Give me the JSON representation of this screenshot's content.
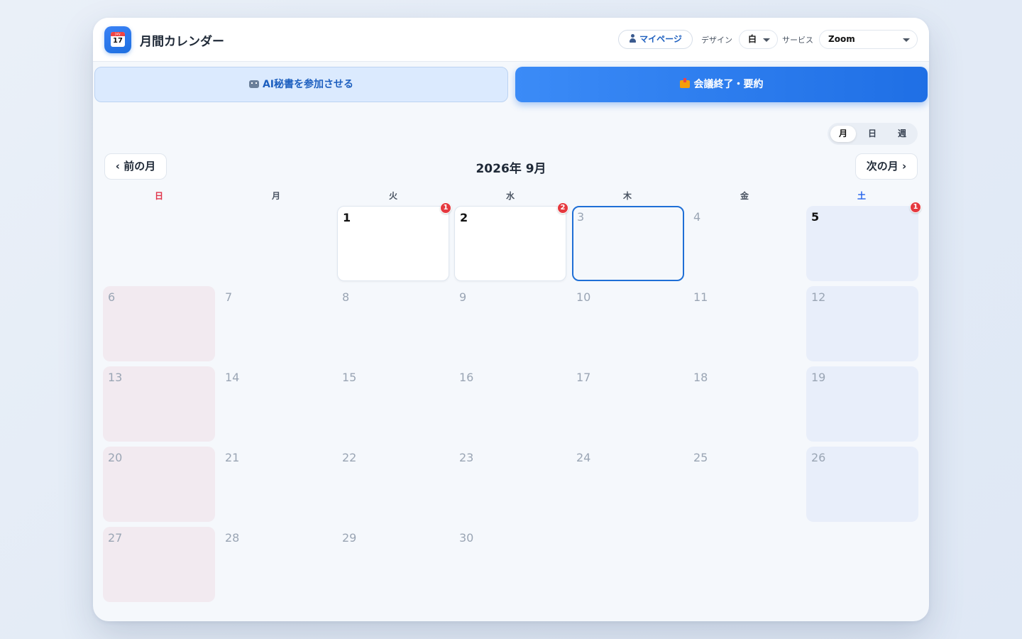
{
  "header": {
    "app_icon": "calendar-icon",
    "app_icon_month": "July",
    "app_icon_day": "17",
    "title": "月間カレンダー",
    "mypage_label": "マイページ",
    "design_label": "デザイン",
    "design_value": "白",
    "service_label": "サービス",
    "service_value": "Zoom"
  },
  "actions": {
    "ai_join": "AI秘書を参加させる",
    "end_meeting": "会議終了・要約"
  },
  "view_toggle": {
    "month": "月",
    "day": "日",
    "week": "週",
    "selected": "月"
  },
  "calendar": {
    "prev": "‹ 前の月",
    "next": "次の月 ›",
    "title": "2026年 9月",
    "weekdays": [
      "日",
      "月",
      "火",
      "水",
      "木",
      "金",
      "土"
    ],
    "today": 3,
    "badges": {
      "1": "1",
      "2": "2",
      "5": "1"
    },
    "days": [
      "1",
      "2",
      "3",
      "4",
      "5",
      "6",
      "7",
      "8",
      "9",
      "10",
      "11",
      "12",
      "13",
      "14",
      "15",
      "16",
      "17",
      "18",
      "19",
      "20",
      "21",
      "22",
      "23",
      "24",
      "25",
      "26",
      "27",
      "28",
      "29",
      "30"
    ]
  },
  "colors": {
    "accent": "#1f6fe5",
    "badge": "#e5393f",
    "sunday": "#e0344a",
    "saturday": "#2563eb"
  }
}
